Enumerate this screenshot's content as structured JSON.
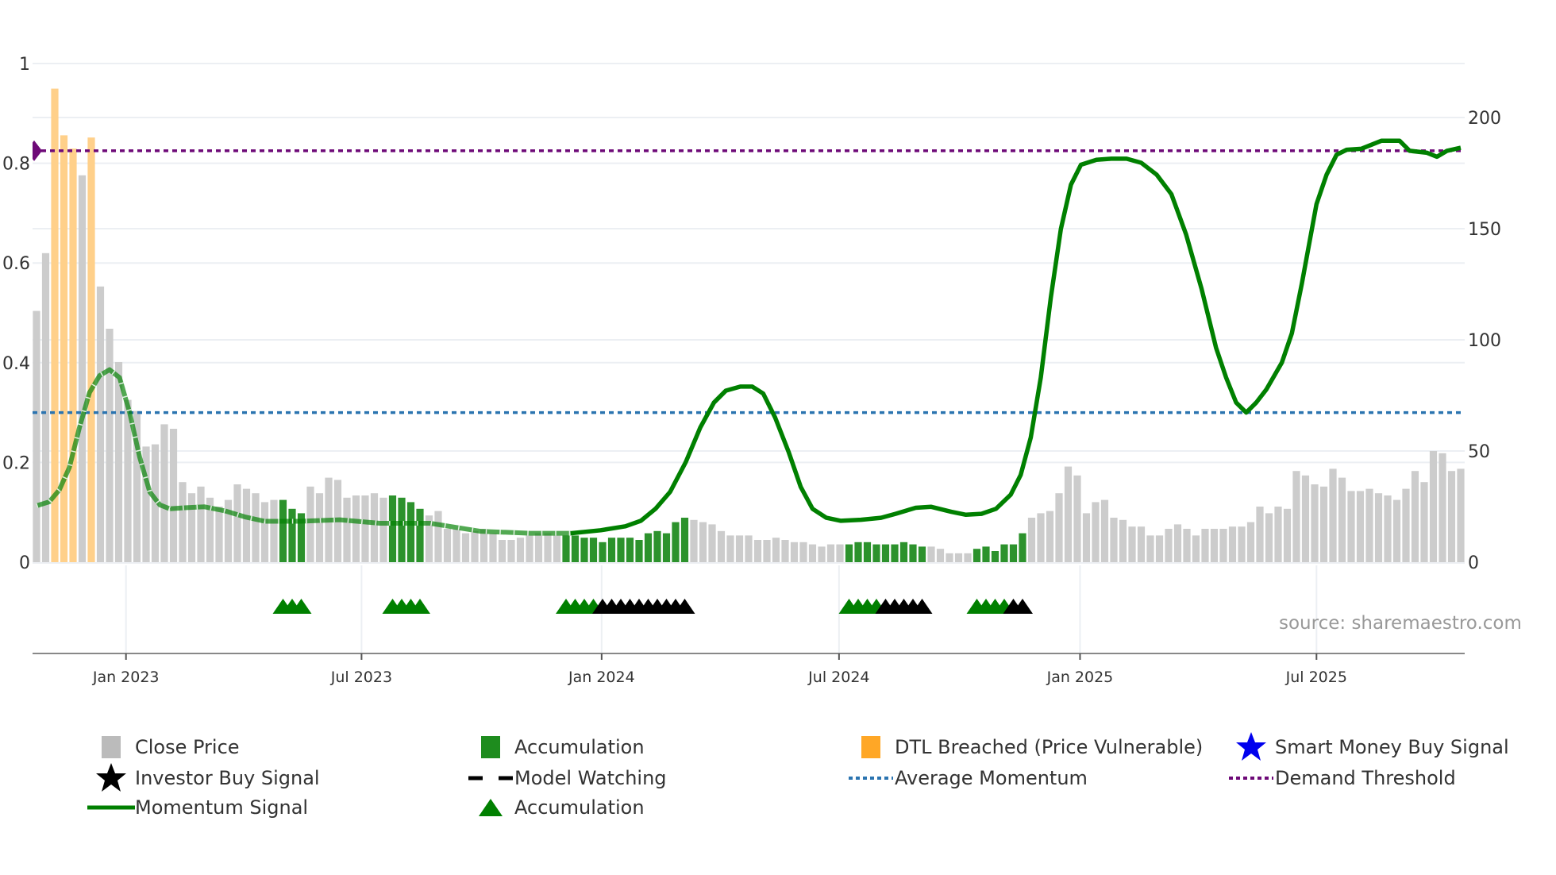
{
  "chart_data": {
    "type": "bar",
    "title": "",
    "xlabel": "",
    "ylabel_left": "",
    "ylabel_right": "",
    "x_unit": "week index",
    "x_ticks": [
      {
        "label": "Jan 2023",
        "x": 9.8
      },
      {
        "label": "Jul 2023",
        "x": 35.6
      },
      {
        "label": "Jan 2024",
        "x": 61.9
      },
      {
        "label": "Jul 2024",
        "x": 87.9
      },
      {
        "label": "Jan 2025",
        "x": 114.3
      },
      {
        "label": "Jul 2025",
        "x": 140.2
      }
    ],
    "y_left": {
      "range": [
        0,
        1
      ],
      "ticks": [
        0,
        0.2,
        0.4,
        0.6,
        0.8,
        1
      ],
      "tick_labels": [
        "0",
        "0.2",
        "0.4",
        "0.6",
        "0.8",
        "1"
      ]
    },
    "y_right": {
      "range": [
        0,
        224
      ],
      "ticks": [
        0,
        50,
        100,
        150,
        200
      ],
      "tick_labels": [
        "0",
        "50",
        "100",
        "150",
        "200"
      ]
    },
    "grid": true,
    "legend_placement": "bottom",
    "close_price": {
      "name": "Close Price",
      "axis": "right",
      "values": [
        113,
        139,
        213,
        192,
        186,
        174,
        191,
        124,
        105,
        90,
        73,
        68,
        52,
        53,
        62,
        60,
        36,
        31,
        34,
        29,
        25,
        28,
        35,
        33,
        31,
        27,
        28,
        28,
        24,
        22,
        34,
        31,
        38,
        37,
        29,
        30,
        30,
        31,
        29,
        30,
        29,
        27,
        24,
        21,
        23,
        15,
        15,
        13,
        14,
        15,
        13,
        10,
        10,
        11,
        12,
        13,
        13,
        12,
        12,
        12,
        11,
        11,
        9,
        11,
        11,
        11,
        10,
        13,
        14,
        13,
        18,
        20,
        19,
        18,
        17,
        14,
        12,
        12,
        12,
        10,
        10,
        11,
        10,
        9,
        9,
        8,
        7,
        8,
        8,
        8,
        9,
        9,
        8,
        8,
        8,
        9,
        8,
        7,
        7,
        6,
        4,
        4,
        4,
        6,
        7,
        5,
        8,
        8,
        13,
        20,
        22,
        23,
        31,
        43,
        39,
        22,
        27,
        28,
        20,
        19,
        16,
        16,
        12,
        12,
        15,
        17,
        15,
        12,
        15,
        15,
        15,
        16,
        16,
        18,
        25,
        22,
        25,
        24,
        41,
        39,
        35,
        34,
        42,
        38,
        32,
        32,
        33,
        31,
        30,
        28,
        33,
        41,
        36,
        50,
        49,
        41,
        42
      ]
    },
    "accumulation_ranges": [
      [
        27,
        29
      ],
      [
        39,
        42
      ],
      [
        58,
        71
      ],
      [
        89,
        97
      ],
      [
        103,
        108
      ]
    ],
    "dtl_breached_indices": [
      2,
      3,
      4,
      6
    ],
    "momentum_signal": {
      "name": "Momentum Signal",
      "axis": "left",
      "watching_until": 58,
      "points": [
        [
          0,
          0.113
        ],
        [
          1.4,
          0.121
        ],
        [
          2.5,
          0.145
        ],
        [
          3.6,
          0.19
        ],
        [
          4.7,
          0.27
        ],
        [
          5.8,
          0.34
        ],
        [
          6.9,
          0.374
        ],
        [
          8.0,
          0.386
        ],
        [
          9.1,
          0.37
        ],
        [
          10.2,
          0.3
        ],
        [
          11.3,
          0.21
        ],
        [
          12.4,
          0.141
        ],
        [
          13.5,
          0.115
        ],
        [
          14.6,
          0.107
        ],
        [
          16.2,
          0.109
        ],
        [
          18.4,
          0.111
        ],
        [
          20.6,
          0.103
        ],
        [
          22.8,
          0.091
        ],
        [
          25.0,
          0.082
        ],
        [
          28.9,
          0.082
        ],
        [
          33.2,
          0.085
        ],
        [
          37.6,
          0.078
        ],
        [
          43.1,
          0.078
        ],
        [
          48.6,
          0.062
        ],
        [
          54.1,
          0.058
        ],
        [
          58.5,
          0.058
        ],
        [
          61.8,
          0.064
        ],
        [
          64.5,
          0.072
        ],
        [
          66.2,
          0.083
        ],
        [
          67.8,
          0.107
        ],
        [
          69.4,
          0.141
        ],
        [
          71.1,
          0.2
        ],
        [
          72.7,
          0.27
        ],
        [
          74.2,
          0.32
        ],
        [
          75.5,
          0.344
        ],
        [
          77.1,
          0.352
        ],
        [
          78.4,
          0.352
        ],
        [
          79.6,
          0.338
        ],
        [
          80.9,
          0.29
        ],
        [
          82.4,
          0.22
        ],
        [
          83.7,
          0.151
        ],
        [
          85.0,
          0.107
        ],
        [
          86.5,
          0.089
        ],
        [
          88.1,
          0.083
        ],
        [
          90.3,
          0.085
        ],
        [
          92.5,
          0.089
        ],
        [
          94.1,
          0.097
        ],
        [
          96.3,
          0.109
        ],
        [
          98.0,
          0.111
        ],
        [
          100.2,
          0.101
        ],
        [
          101.8,
          0.095
        ],
        [
          103.5,
          0.097
        ],
        [
          105.1,
          0.107
        ],
        [
          106.7,
          0.135
        ],
        [
          107.8,
          0.175
        ],
        [
          108.9,
          0.25
        ],
        [
          110.0,
          0.37
        ],
        [
          111.1,
          0.53
        ],
        [
          112.2,
          0.668
        ],
        [
          113.3,
          0.757
        ],
        [
          114.4,
          0.797
        ],
        [
          116.1,
          0.807
        ],
        [
          117.7,
          0.809
        ],
        [
          119.4,
          0.809
        ],
        [
          121.0,
          0.801
        ],
        [
          122.7,
          0.777
        ],
        [
          124.3,
          0.738
        ],
        [
          125.9,
          0.658
        ],
        [
          127.6,
          0.549
        ],
        [
          129.2,
          0.43
        ],
        [
          130.3,
          0.37
        ],
        [
          131.4,
          0.32
        ],
        [
          132.5,
          0.3
        ],
        [
          133.6,
          0.32
        ],
        [
          134.7,
          0.346
        ],
        [
          136.4,
          0.4
        ],
        [
          137.5,
          0.459
        ],
        [
          138.6,
          0.559
        ],
        [
          140.2,
          0.718
        ],
        [
          141.3,
          0.777
        ],
        [
          142.4,
          0.817
        ],
        [
          143.5,
          0.827
        ],
        [
          145.1,
          0.829
        ],
        [
          147.3,
          0.845
        ],
        [
          149.3,
          0.845
        ],
        [
          150.4,
          0.825
        ],
        [
          152.3,
          0.821
        ],
        [
          153.4,
          0.813
        ],
        [
          154.5,
          0.825
        ],
        [
          156.0,
          0.831
        ]
      ]
    },
    "average_momentum": {
      "name": "Average Momentum",
      "value": 0.3
    },
    "demand_threshold": {
      "name": "Demand Threshold",
      "value": 0.825
    },
    "accumulation_markers": [
      58,
      59,
      60,
      61,
      27,
      28,
      29,
      39,
      40,
      41,
      42,
      89,
      90,
      91,
      92,
      103,
      104,
      105,
      106
    ],
    "black_markers": [
      62,
      63,
      64,
      65,
      66,
      67,
      68,
      69,
      70,
      71,
      93,
      94,
      95,
      96,
      97,
      107,
      108
    ],
    "source": "source: sharemaestro.com",
    "legend": [
      {
        "label": "Close Price",
        "icon": "gray-square"
      },
      {
        "label": "Accumulation",
        "icon": "green-square"
      },
      {
        "label": "DTL Breached (Price Vulnerable)",
        "icon": "orange-square"
      },
      {
        "label": "Smart Money Buy Signal",
        "icon": "blue-star"
      },
      {
        "label": "Investor Buy Signal",
        "icon": "black-star"
      },
      {
        "label": "Model Watching",
        "icon": "black-dashed-line"
      },
      {
        "label": "Average Momentum",
        "icon": "blue-dotted-line"
      },
      {
        "label": "Demand Threshold",
        "icon": "purple-dotted-line"
      },
      {
        "label": "Momentum Signal",
        "icon": "green-line"
      },
      {
        "label": "Accumulation",
        "icon": "green-triangle"
      }
    ],
    "colors": {
      "close": "#cccccc",
      "accumulation": "#2c922c",
      "dtl": "#ffd08a",
      "momentum": "#008000",
      "avg": "#2b74b0",
      "demand": "#6e0a78",
      "grid": "#eceff3"
    }
  }
}
